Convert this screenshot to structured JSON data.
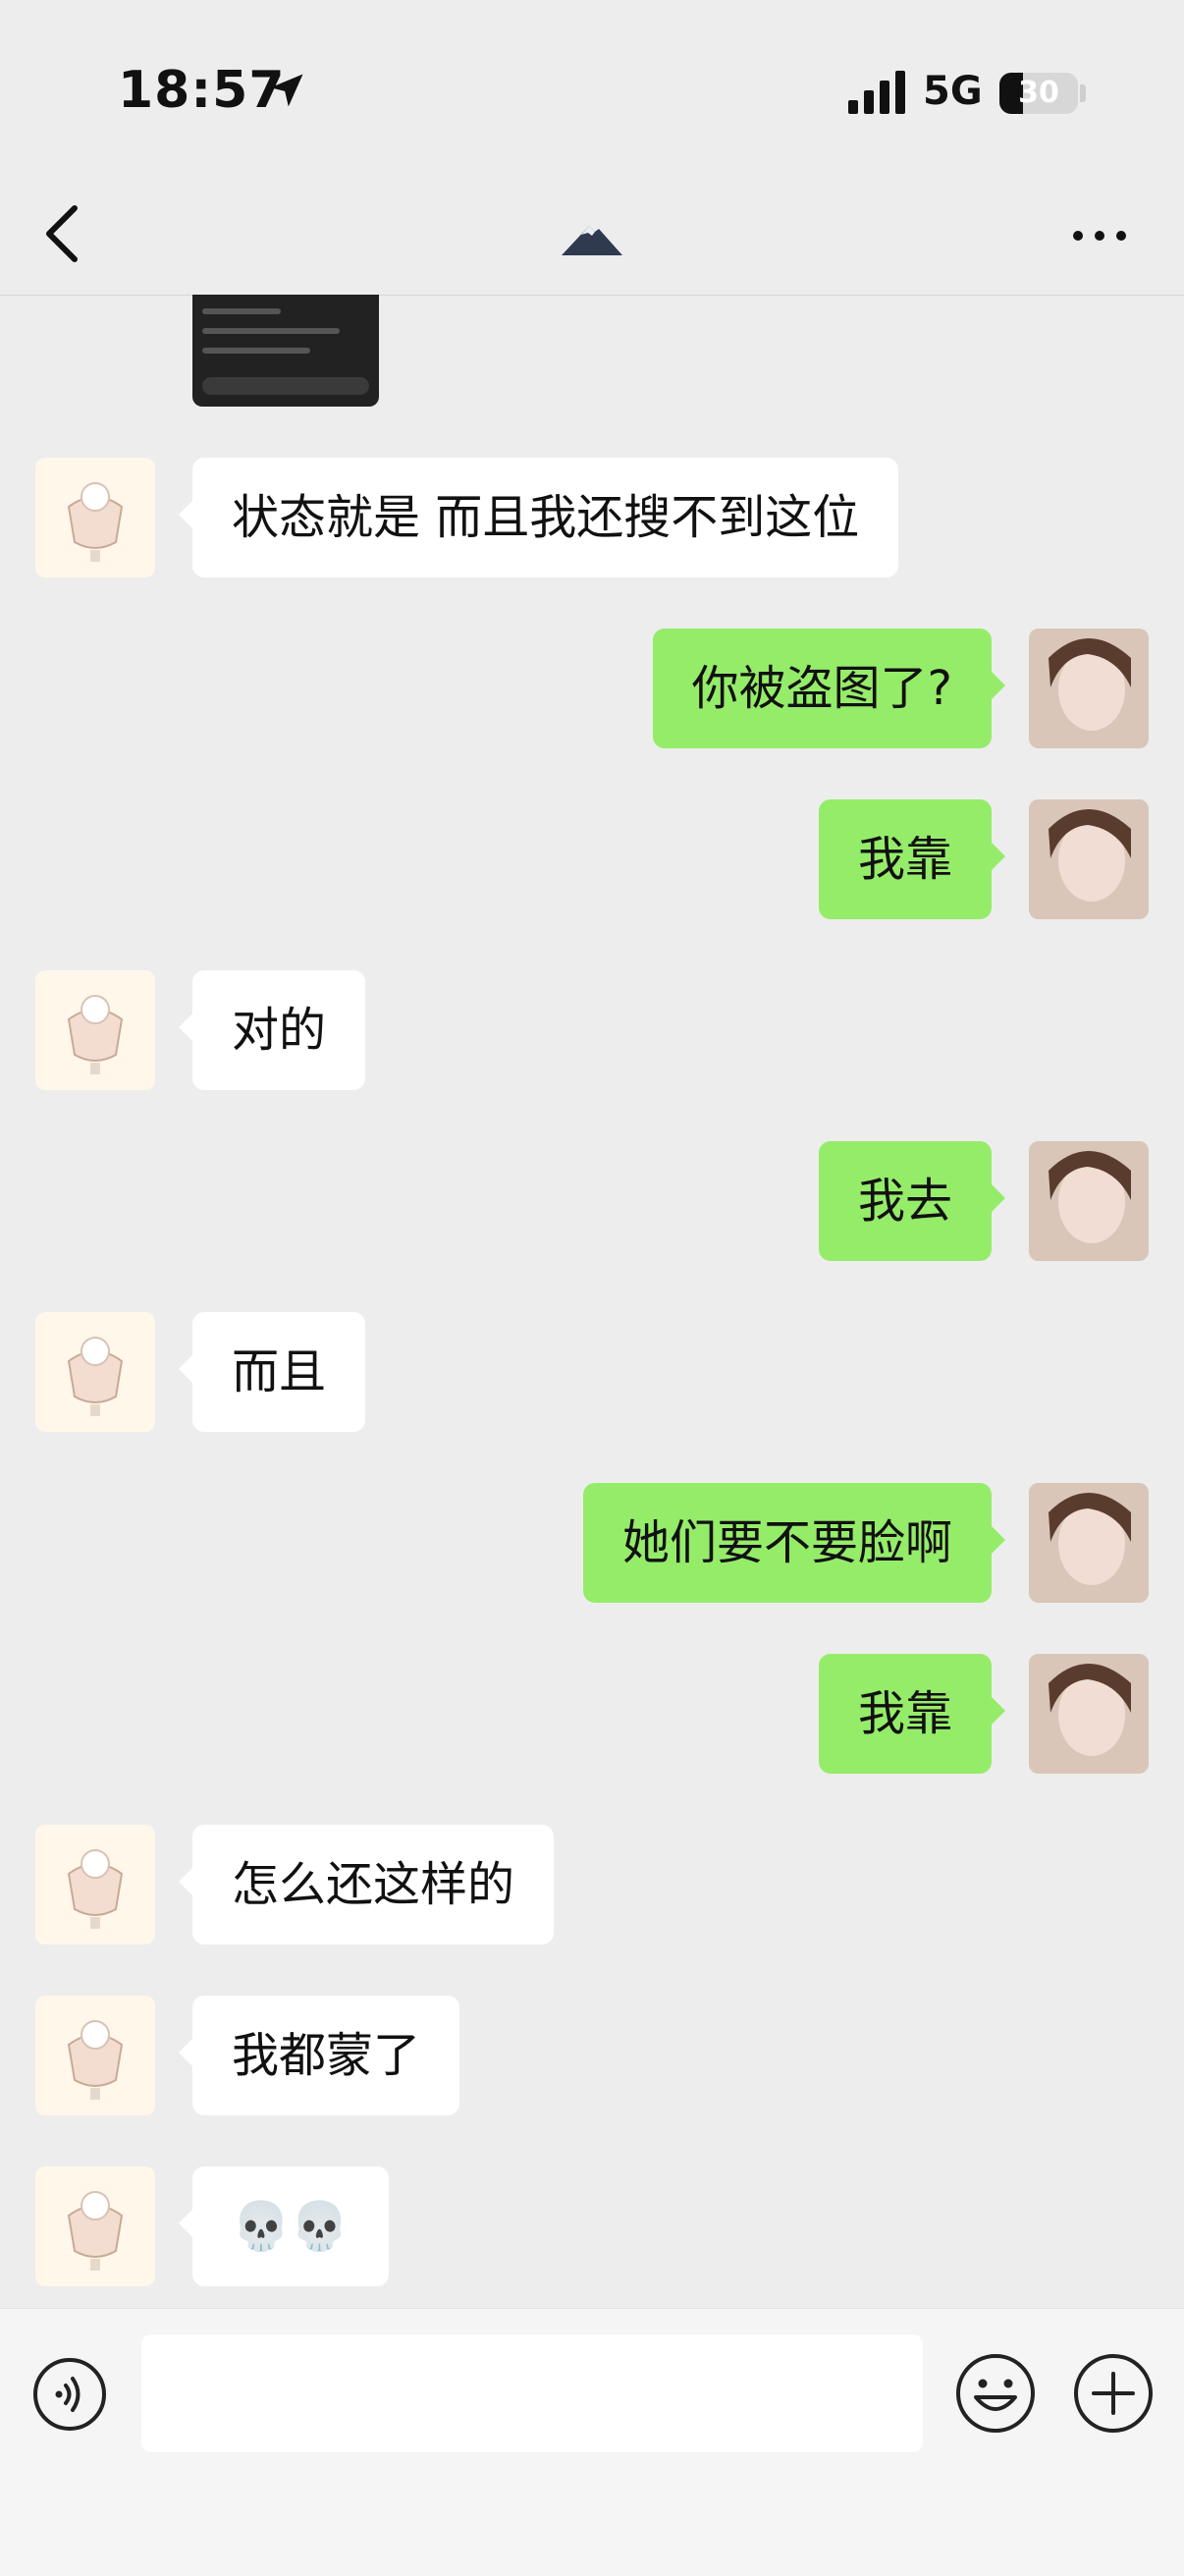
{
  "status": {
    "time": "18:57",
    "network": "5G",
    "battery": "30"
  },
  "chat": {
    "messages": [
      {
        "side": "in",
        "text": "状态就是 而且我还搜不到这位"
      },
      {
        "side": "out",
        "text": "你被盗图了?"
      },
      {
        "side": "out",
        "text": "我靠"
      },
      {
        "side": "in",
        "text": "对的"
      },
      {
        "side": "out",
        "text": "我去"
      },
      {
        "side": "in",
        "text": "而且"
      },
      {
        "side": "out",
        "text": "她们要不要脸啊"
      },
      {
        "side": "out",
        "text": "我靠"
      },
      {
        "side": "in",
        "text": "怎么还这样的"
      },
      {
        "side": "in",
        "text": "我都蒙了"
      },
      {
        "side": "in",
        "text": "💀💀"
      }
    ]
  },
  "colors": {
    "incoming": "#ffffff",
    "outgoing": "#95ec69",
    "background": "#ededed"
  }
}
